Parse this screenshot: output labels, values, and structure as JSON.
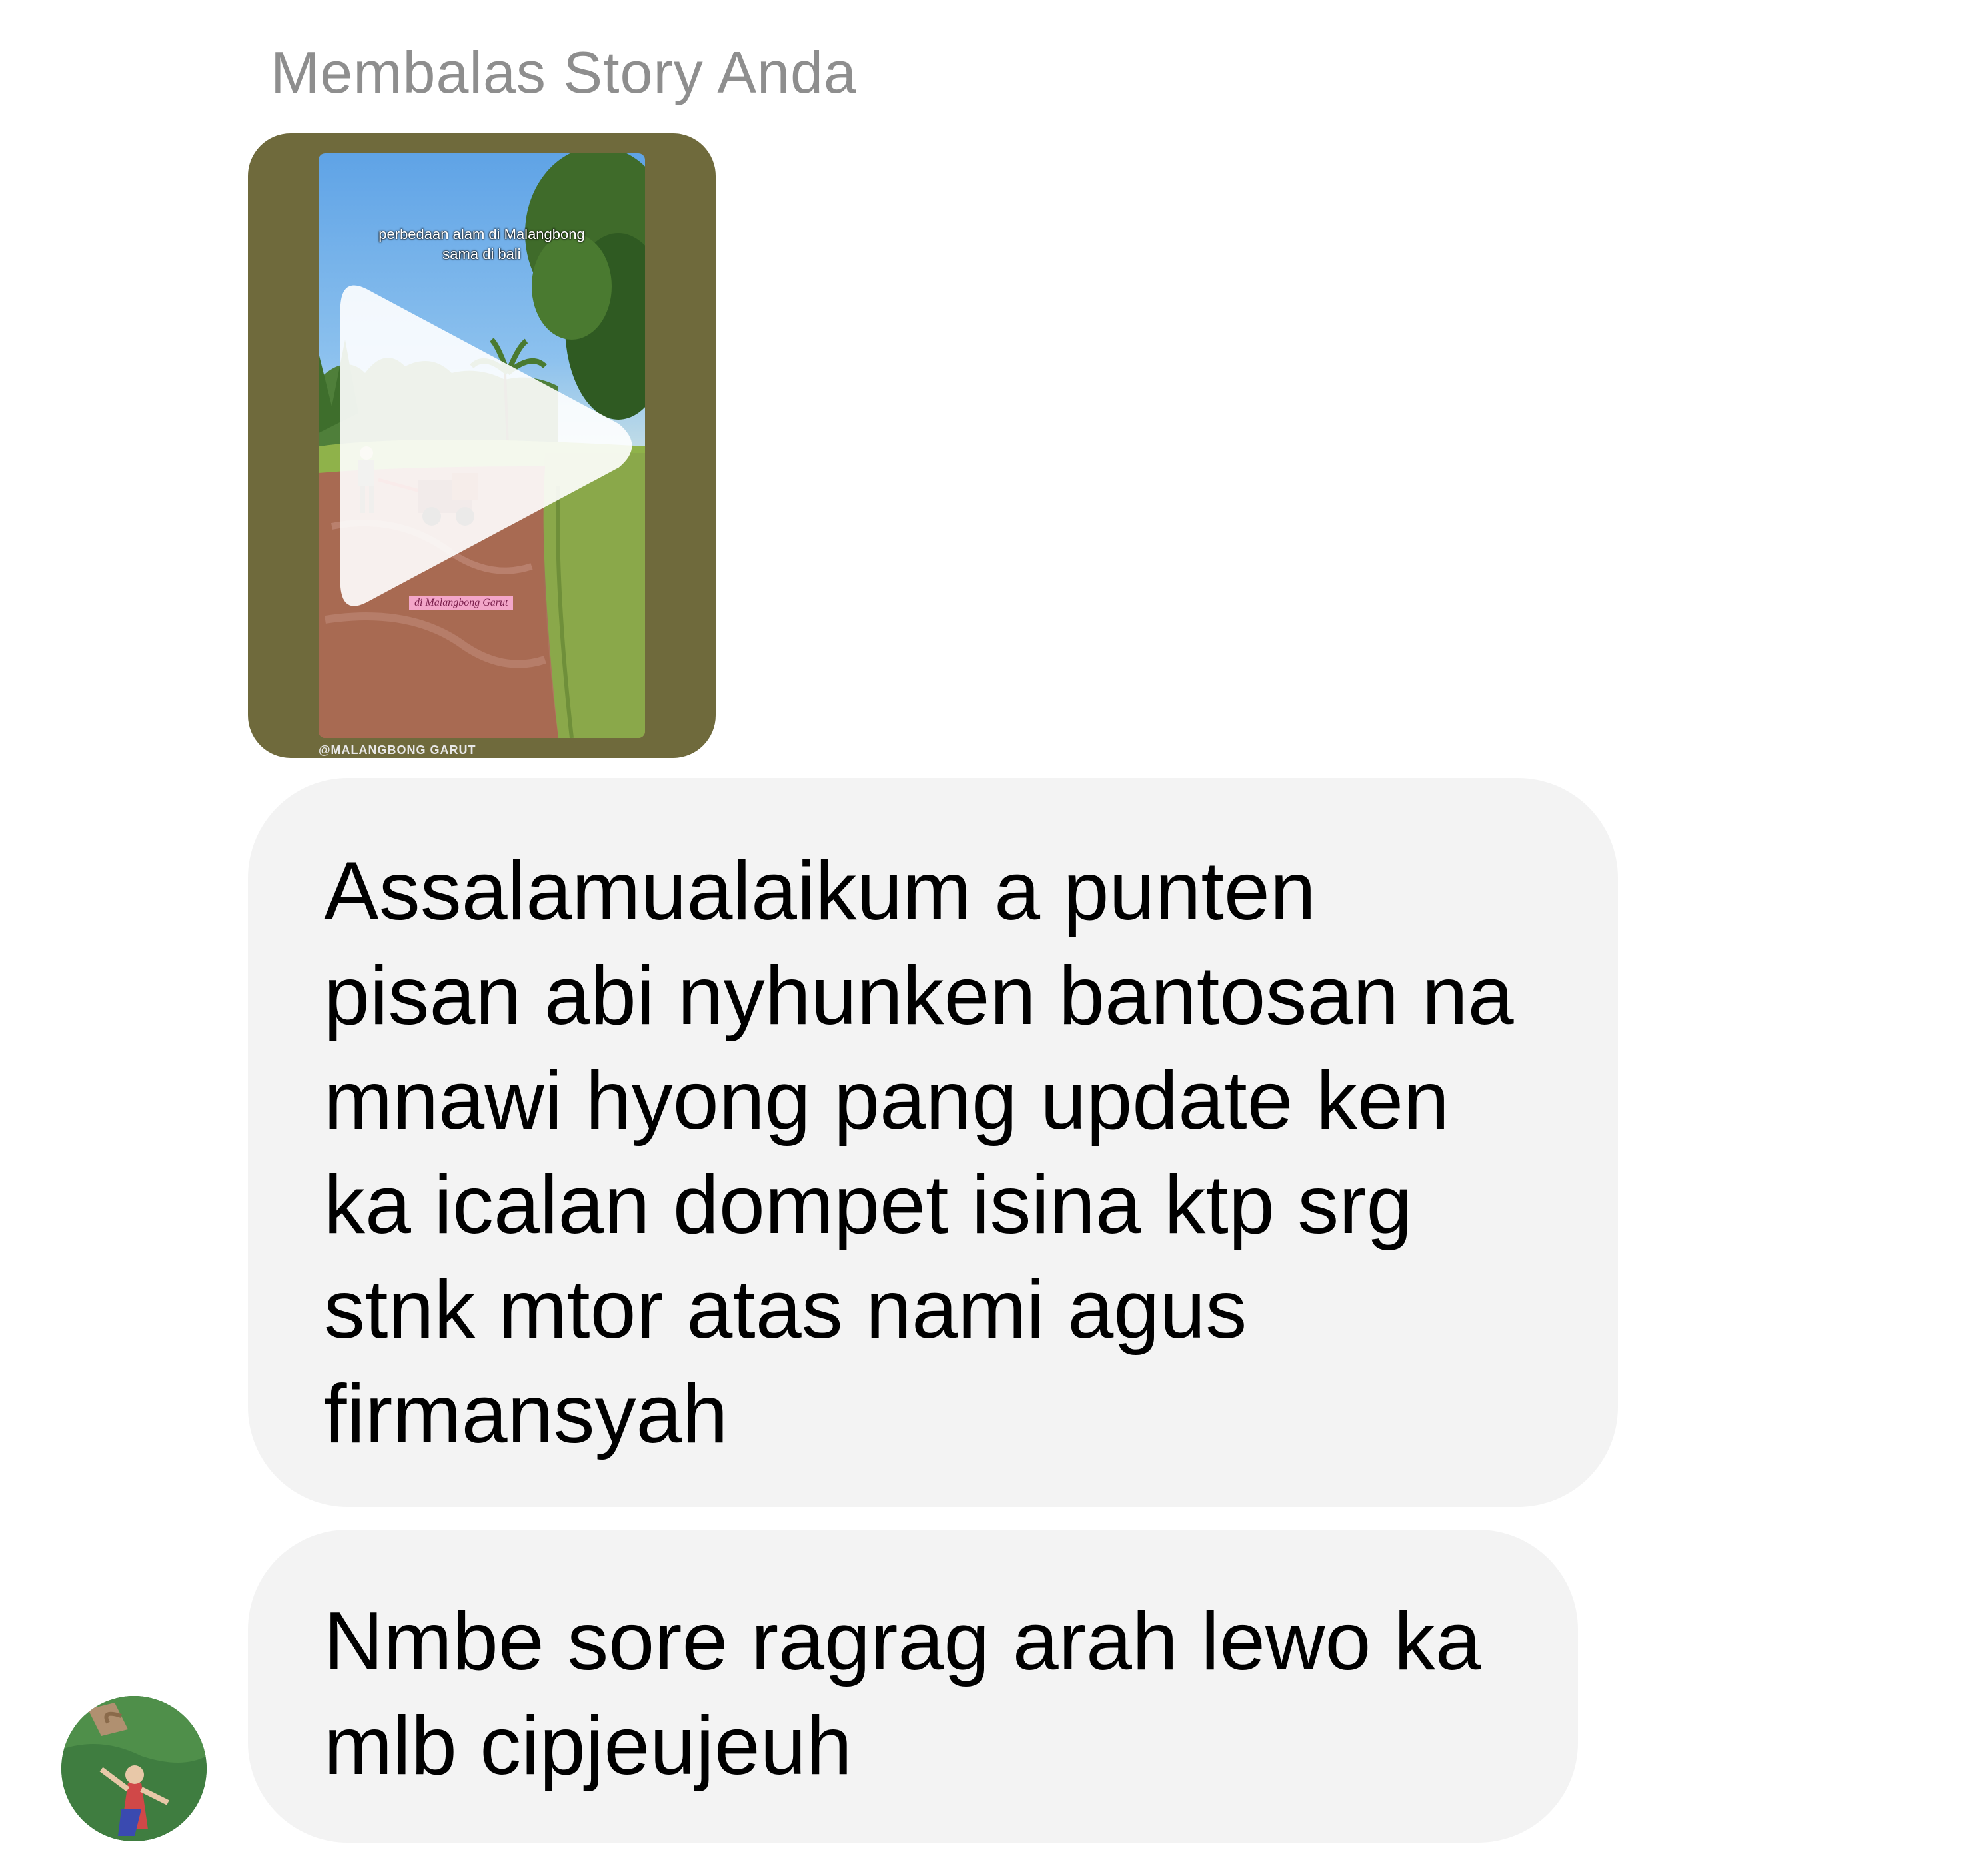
{
  "header": {
    "reply_label": "Membalas Story Anda"
  },
  "story": {
    "caption_line1": "perbedaan alam di Malangbong",
    "caption_line2": "sama di bali",
    "location_tag": "di Malangbong Garut",
    "handle": "@MALANGBONG GARUT",
    "play_icon": "play-icon"
  },
  "messages": [
    {
      "lines": [
        "Assalamualaikum a punten",
        "pisan abi nyhunken bantosan na",
        "mnawi hyong pang update ken",
        "ka icalan dompet isina ktp srg",
        "stnk mtor atas nami agus",
        "firmansyah"
      ]
    },
    {
      "lines": [
        "Nmbe sore ragrag arah lewo ka",
        "mlb cipjeujeuh"
      ]
    }
  ],
  "sender": {
    "avatar": "avatar"
  },
  "colors": {
    "bubble_bg": "#f3f3f3",
    "label_gray": "#8e8e8e",
    "story_border": "#6f6a3c"
  }
}
